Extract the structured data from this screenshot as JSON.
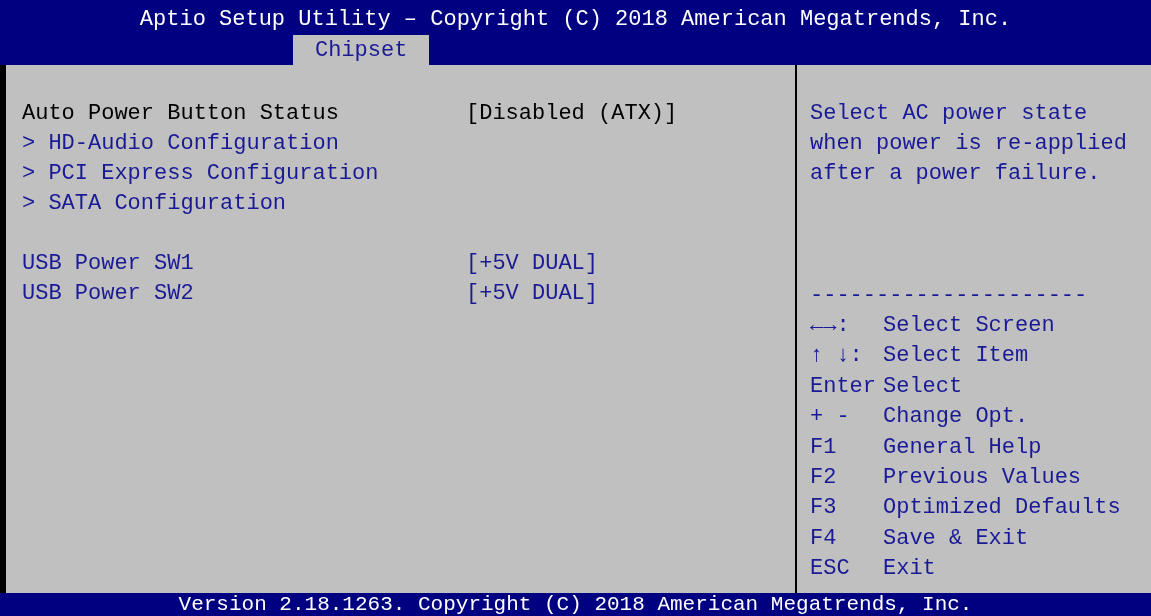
{
  "header": {
    "title": "Aptio Setup Utility – Copyright (C) 2018 American Megatrends, Inc."
  },
  "tabs": [
    {
      "label": "Chipset",
      "selected": true
    }
  ],
  "settings": [
    {
      "kind": "setting",
      "label": "Auto Power Button Status",
      "value": "[Disabled (ATX)]",
      "selected": true
    },
    {
      "kind": "submenu",
      "label": "> HD-Audio Configuration",
      "selected": false
    },
    {
      "kind": "submenu",
      "label": "> PCI Express Configuration",
      "selected": false
    },
    {
      "kind": "submenu",
      "label": "> SATA Configuration",
      "selected": false
    },
    {
      "kind": "spacer"
    },
    {
      "kind": "setting",
      "label": "USB Power SW1",
      "value": "[+5V DUAL]",
      "selected": false
    },
    {
      "kind": "setting",
      "label": "USB Power SW2",
      "value": "[+5V DUAL]",
      "selected": false
    }
  ],
  "help": {
    "lines": [
      "Select AC power state",
      "when power is re-applied",
      "after a power failure."
    ],
    "separator": "---------------------"
  },
  "keys": [
    {
      "key": "←→:",
      "action": "Select Screen"
    },
    {
      "key": "↑ ↓:",
      "action": "Select Item"
    },
    {
      "key": "Enter",
      "action": "Select"
    },
    {
      "key": "+ -",
      "action": "Change Opt."
    },
    {
      "key": "F1",
      "action": "General Help"
    },
    {
      "key": "F2",
      "action": "Previous Values"
    },
    {
      "key": "F3",
      "action": "Optimized Defaults"
    },
    {
      "key": "F4",
      "action": "Save & Exit"
    },
    {
      "key": "ESC",
      "action": "Exit"
    }
  ],
  "footer": {
    "text": "Version 2.18.1263. Copyright (C) 2018 American Megatrends, Inc."
  }
}
